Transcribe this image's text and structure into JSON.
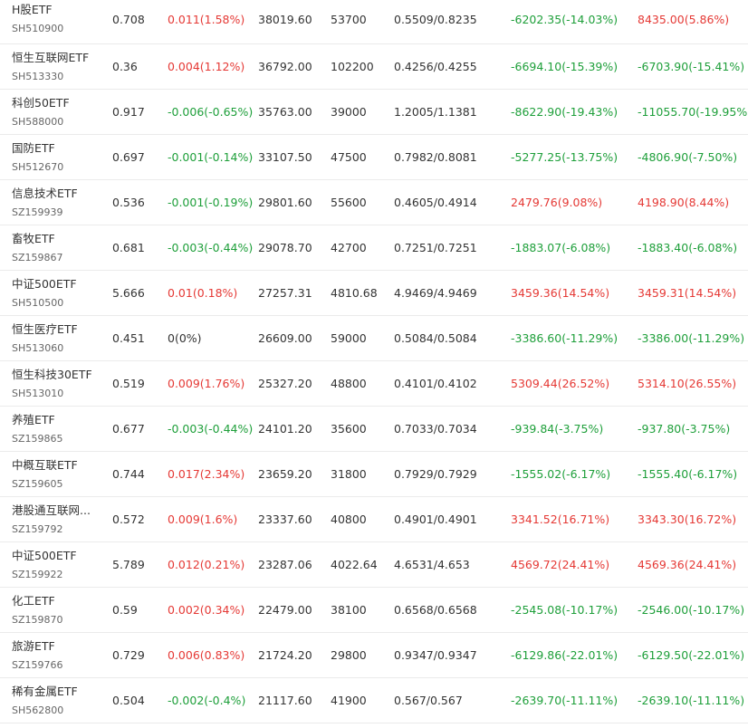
{
  "colors": {
    "up": "#e53935",
    "down": "#1e9f3a",
    "flat": "#333333"
  },
  "rows": [
    {
      "name": "H股ETF",
      "code": "SH510900",
      "price": "0.708",
      "change": "0.011(1.58%)",
      "change_dir": "up",
      "turnover": "38019.60",
      "volume": "53700",
      "range": "0.5509/0.8235",
      "pl1": "-6202.35(-14.03%)",
      "pl1_dir": "down",
      "pl2": "8435.00(5.86%)",
      "pl2_dir": "up"
    },
    {
      "name": "恒生互联网ETF",
      "code": "SH513330",
      "price": "0.36",
      "change": "0.004(1.12%)",
      "change_dir": "up",
      "turnover": "36792.00",
      "volume": "102200",
      "range": "0.4256/0.4255",
      "pl1": "-6694.10(-15.39%)",
      "pl1_dir": "down",
      "pl2": "-6703.90(-15.41%)",
      "pl2_dir": "down"
    },
    {
      "name": "科创50ETF",
      "code": "SH588000",
      "price": "0.917",
      "change": "-0.006(-0.65%)",
      "change_dir": "down",
      "turnover": "35763.00",
      "volume": "39000",
      "range": "1.2005/1.1381",
      "pl1": "-8622.90(-19.43%)",
      "pl1_dir": "down",
      "pl2": "-11055.70(-19.95%)",
      "pl2_dir": "down"
    },
    {
      "name": "国防ETF",
      "code": "SH512670",
      "price": "0.697",
      "change": "-0.001(-0.14%)",
      "change_dir": "down",
      "turnover": "33107.50",
      "volume": "47500",
      "range": "0.7982/0.8081",
      "pl1": "-5277.25(-13.75%)",
      "pl1_dir": "down",
      "pl2": "-4806.90(-7.50%)",
      "pl2_dir": "down"
    },
    {
      "name": "信息技术ETF",
      "code": "SZ159939",
      "price": "0.536",
      "change": "-0.001(-0.19%)",
      "change_dir": "down",
      "turnover": "29801.60",
      "volume": "55600",
      "range": "0.4605/0.4914",
      "pl1": "2479.76(9.08%)",
      "pl1_dir": "up",
      "pl2": "4198.90(8.44%)",
      "pl2_dir": "up"
    },
    {
      "name": "畜牧ETF",
      "code": "SZ159867",
      "price": "0.681",
      "change": "-0.003(-0.44%)",
      "change_dir": "down",
      "turnover": "29078.70",
      "volume": "42700",
      "range": "0.7251/0.7251",
      "pl1": "-1883.07(-6.08%)",
      "pl1_dir": "down",
      "pl2": "-1883.40(-6.08%)",
      "pl2_dir": "down"
    },
    {
      "name": "中证500ETF",
      "code": "SH510500",
      "price": "5.666",
      "change": "0.01(0.18%)",
      "change_dir": "up",
      "turnover": "27257.31",
      "volume": "4810.68",
      "range": "4.9469/4.9469",
      "pl1": "3459.36(14.54%)",
      "pl1_dir": "up",
      "pl2": "3459.31(14.54%)",
      "pl2_dir": "up"
    },
    {
      "name": "恒生医疗ETF",
      "code": "SH513060",
      "price": "0.451",
      "change": "0(0%)",
      "change_dir": "flat",
      "turnover": "26609.00",
      "volume": "59000",
      "range": "0.5084/0.5084",
      "pl1": "-3386.60(-11.29%)",
      "pl1_dir": "down",
      "pl2": "-3386.00(-11.29%)",
      "pl2_dir": "down"
    },
    {
      "name": "恒生科技30ETF",
      "code": "SH513010",
      "price": "0.519",
      "change": "0.009(1.76%)",
      "change_dir": "up",
      "turnover": "25327.20",
      "volume": "48800",
      "range": "0.4101/0.4102",
      "pl1": "5309.44(26.52%)",
      "pl1_dir": "up",
      "pl2": "5314.10(26.55%)",
      "pl2_dir": "up"
    },
    {
      "name": "养殖ETF",
      "code": "SZ159865",
      "price": "0.677",
      "change": "-0.003(-0.44%)",
      "change_dir": "down",
      "turnover": "24101.20",
      "volume": "35600",
      "range": "0.7033/0.7034",
      "pl1": "-939.84(-3.75%)",
      "pl1_dir": "down",
      "pl2": "-937.80(-3.75%)",
      "pl2_dir": "down"
    },
    {
      "name": "中概互联ETF",
      "code": "SZ159605",
      "price": "0.744",
      "change": "0.017(2.34%)",
      "change_dir": "up",
      "turnover": "23659.20",
      "volume": "31800",
      "range": "0.7929/0.7929",
      "pl1": "-1555.02(-6.17%)",
      "pl1_dir": "down",
      "pl2": "-1555.40(-6.17%)",
      "pl2_dir": "down"
    },
    {
      "name": "港股通互联网...",
      "code": "SZ159792",
      "price": "0.572",
      "change": "0.009(1.6%)",
      "change_dir": "up",
      "turnover": "23337.60",
      "volume": "40800",
      "range": "0.4901/0.4901",
      "pl1": "3341.52(16.71%)",
      "pl1_dir": "up",
      "pl2": "3343.30(16.72%)",
      "pl2_dir": "up"
    },
    {
      "name": "中证500ETF",
      "code": "SZ159922",
      "price": "5.789",
      "change": "0.012(0.21%)",
      "change_dir": "up",
      "turnover": "23287.06",
      "volume": "4022.64",
      "range": "4.6531/4.653",
      "pl1": "4569.72(24.41%)",
      "pl1_dir": "up",
      "pl2": "4569.36(24.41%)",
      "pl2_dir": "up"
    },
    {
      "name": "化工ETF",
      "code": "SZ159870",
      "price": "0.59",
      "change": "0.002(0.34%)",
      "change_dir": "up",
      "turnover": "22479.00",
      "volume": "38100",
      "range": "0.6568/0.6568",
      "pl1": "-2545.08(-10.17%)",
      "pl1_dir": "down",
      "pl2": "-2546.00(-10.17%)",
      "pl2_dir": "down"
    },
    {
      "name": "旅游ETF",
      "code": "SZ159766",
      "price": "0.729",
      "change": "0.006(0.83%)",
      "change_dir": "up",
      "turnover": "21724.20",
      "volume": "29800",
      "range": "0.9347/0.9347",
      "pl1": "-6129.86(-22.01%)",
      "pl1_dir": "down",
      "pl2": "-6129.50(-22.01%)",
      "pl2_dir": "down"
    },
    {
      "name": "稀有金属ETF",
      "code": "SH562800",
      "price": "0.504",
      "change": "-0.002(-0.4%)",
      "change_dir": "down",
      "turnover": "21117.60",
      "volume": "41900",
      "range": "0.567/0.567",
      "pl1": "-2639.70(-11.11%)",
      "pl1_dir": "down",
      "pl2": "-2639.10(-11.11%)",
      "pl2_dir": "down"
    }
  ]
}
